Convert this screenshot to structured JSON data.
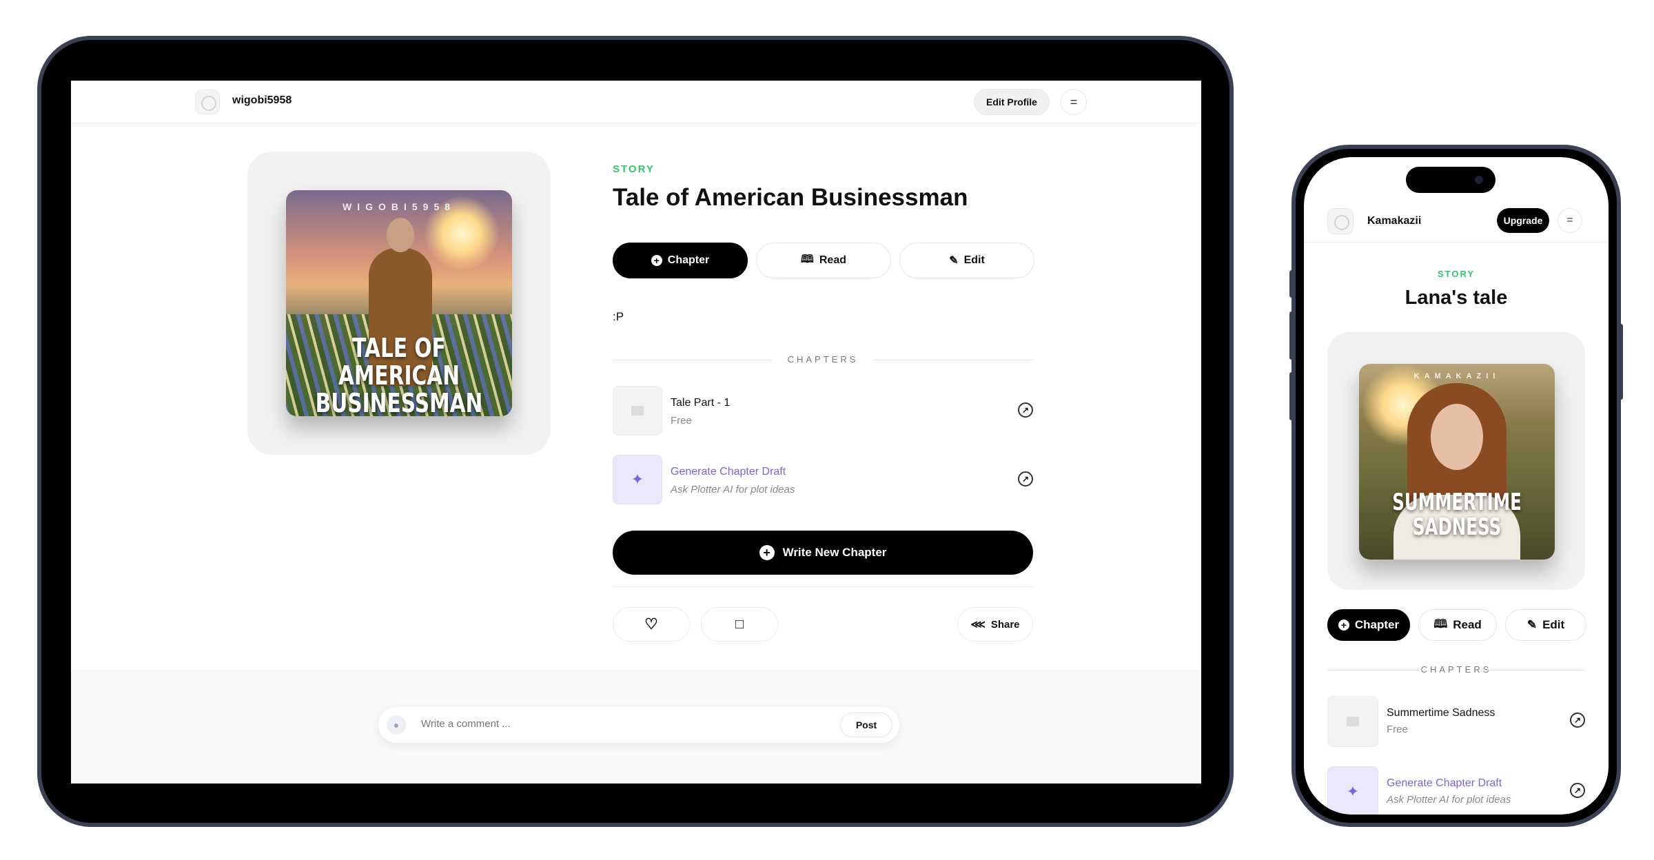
{
  "tablet": {
    "header": {
      "username": "wigobi5958",
      "edit_profile": "Edit Profile",
      "menu_glyph": "="
    },
    "cover": {
      "author_watermark": "WIGOBI5958",
      "title_line1": "TALE OF AMERICAN",
      "title_line2": "BUSINESSMAN"
    },
    "story_label": "STORY",
    "title": "Tale of American Businessman",
    "buttons": {
      "chapter": "Chapter",
      "read": "Read",
      "edit": "Edit"
    },
    "description": ":P",
    "chapters_heading": "CHAPTERS",
    "chapters": [
      {
        "title": "Tale Part - 1",
        "subtitle": "Free"
      }
    ],
    "ai_draft": {
      "title": "Generate Chapter Draft",
      "subtitle": "Ask Plotter AI for plot ideas"
    },
    "write_new": "Write New Chapter",
    "share": "Share",
    "comment": {
      "placeholder": "Write a comment ...",
      "post": "Post"
    }
  },
  "phone": {
    "header": {
      "username": "Kamakazii",
      "upgrade": "Upgrade",
      "menu_glyph": "="
    },
    "story_label": "STORY",
    "title": "Lana's tale",
    "cover": {
      "author_watermark": "KAMAKAZII",
      "title_line1": "SUMMERTIME",
      "title_line2": "SADNESS"
    },
    "buttons": {
      "chapter": "Chapter",
      "read": "Read",
      "edit": "Edit"
    },
    "chapters_heading": "CHAPTERS",
    "chapters": [
      {
        "title": "Summertime Sadness",
        "subtitle": "Free"
      }
    ],
    "ai_draft": {
      "title": "Generate Chapter Draft",
      "subtitle": "Ask Plotter AI for plot ideas"
    }
  },
  "colors": {
    "story_green": "#2fc86a",
    "ai_purple": "#7b63e0",
    "device_frame": "#3b4154"
  },
  "icons": [
    "plus-circle-icon",
    "book-icon",
    "pencil-icon",
    "arrow-up-right-icon",
    "sparkle-icon",
    "heart-icon",
    "comment-icon",
    "share-icon",
    "user-icon",
    "image-placeholder-icon",
    "menu-icon"
  ]
}
